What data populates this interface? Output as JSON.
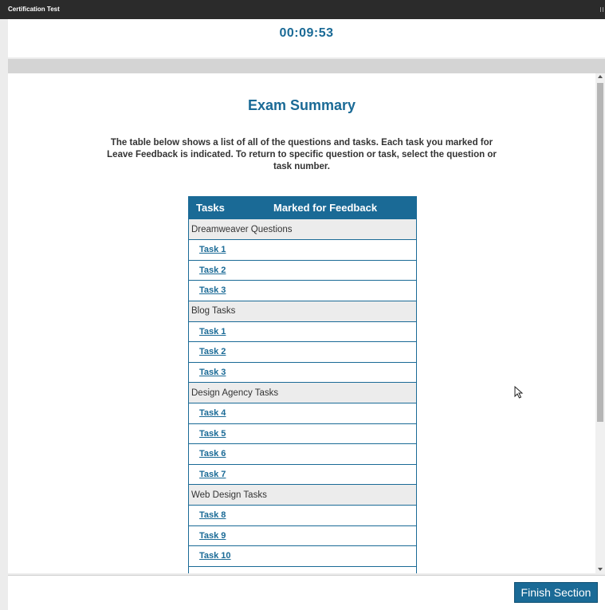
{
  "window": {
    "title": "Certification Test"
  },
  "timer": "00:09:53",
  "summary": {
    "heading": "Exam Summary",
    "intro": "The table below shows a list of all of the questions and tasks. Each task you marked for Leave Feedback is indicated. To return to specific question or task, select the question or task number."
  },
  "table": {
    "headers": {
      "tasks": "Tasks",
      "marked": "Marked for Feedback"
    },
    "sections": [
      {
        "name": "Dreamweaver Questions",
        "tasks": [
          "Task 1",
          "Task 2",
          "Task 3"
        ]
      },
      {
        "name": "Blog Tasks",
        "tasks": [
          "Task 1",
          "Task 2",
          "Task 3"
        ]
      },
      {
        "name": "Design Agency Tasks",
        "tasks": [
          "Task 4",
          "Task 5",
          "Task 6",
          "Task 7"
        ]
      },
      {
        "name": "Web Design Tasks",
        "tasks": [
          "Task 8",
          "Task 9",
          "Task 10"
        ]
      }
    ]
  },
  "footer": {
    "finish_label": "Finish Section"
  },
  "colors": {
    "accent": "#1a6a96",
    "titlebar": "#2b2b2b",
    "section_bg": "#ececec"
  },
  "icons": [
    "scroll-up-arrow-icon",
    "scroll-down-arrow-icon",
    "mouse-cursor-icon"
  ]
}
